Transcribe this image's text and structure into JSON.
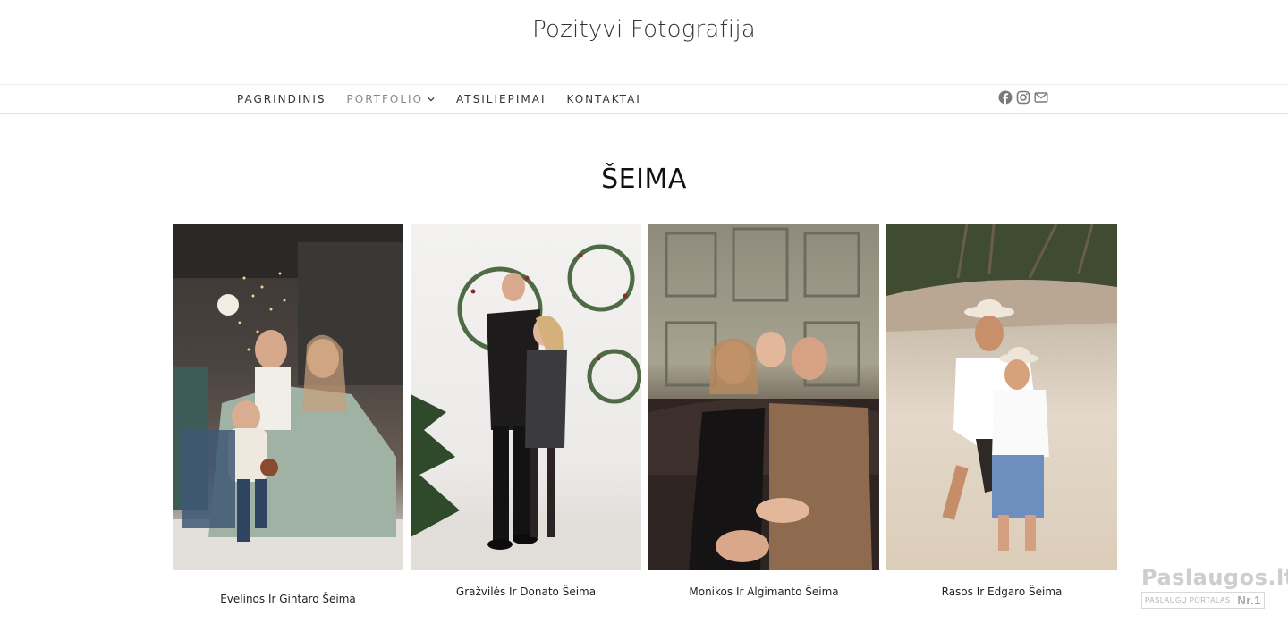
{
  "site": {
    "title": "Pozityvi Fotografija"
  },
  "nav": {
    "items": [
      {
        "label": "PAGRINDINIS"
      },
      {
        "label": "PORTFOLIO"
      },
      {
        "label": "ATSILIEPIMAI"
      },
      {
        "label": "KONTAKTAI"
      }
    ],
    "social_icons": [
      "facebook-icon",
      "instagram-icon",
      "mail-icon"
    ]
  },
  "page": {
    "heading": "ŠEIMA"
  },
  "gallery": [
    {
      "caption": "Evelinos Ir Gintaro Šeima"
    },
    {
      "caption": "Gražvilės Ir Donato Šeima"
    },
    {
      "caption": "Monikos Ir Algimanto Šeima"
    },
    {
      "caption": "Rasos Ir Edgaro Šeima"
    }
  ],
  "badge": {
    "name": "Paslaugos.lt",
    "subtitle": "PASLAUGŲ PORTALAS",
    "rank": "Nr.1"
  }
}
